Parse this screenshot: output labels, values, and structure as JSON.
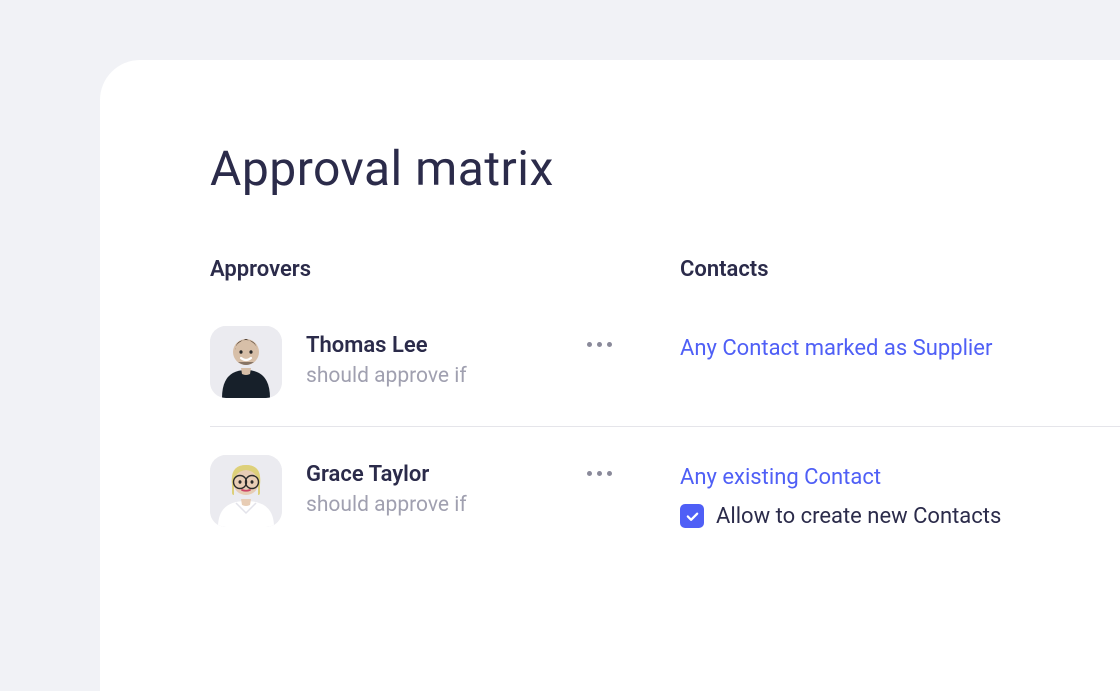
{
  "title": "Approval matrix",
  "headers": {
    "approvers": "Approvers",
    "contacts": "Contacts"
  },
  "rows": [
    {
      "name": "Thomas Lee",
      "sub": "should approve if",
      "contact_link": "Any Contact marked as Supplier",
      "allow_create": false
    },
    {
      "name": "Grace Taylor",
      "sub": "should approve if",
      "contact_link": "Any existing Contact",
      "allow_create": true,
      "allow_create_label": "Allow to create new Contacts"
    }
  ]
}
